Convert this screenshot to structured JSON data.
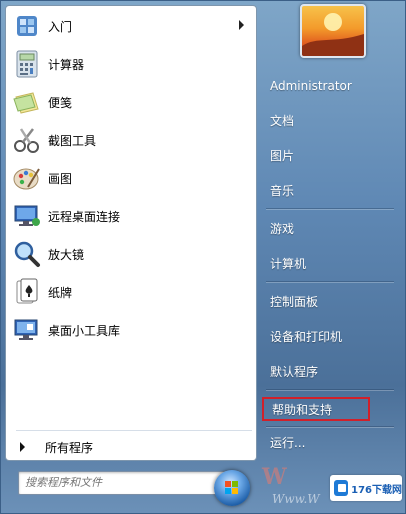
{
  "programs": [
    {
      "label": "入门",
      "icon": "getting-started-icon",
      "has_submenu": true
    },
    {
      "label": "计算器",
      "icon": "calculator-icon",
      "has_submenu": false
    },
    {
      "label": "便笺",
      "icon": "sticky-notes-icon",
      "has_submenu": false
    },
    {
      "label": "截图工具",
      "icon": "snipping-tool-icon",
      "has_submenu": false
    },
    {
      "label": "画图",
      "icon": "paint-icon",
      "has_submenu": false
    },
    {
      "label": "远程桌面连接",
      "icon": "remote-desktop-icon",
      "has_submenu": false
    },
    {
      "label": "放大镜",
      "icon": "magnifier-icon",
      "has_submenu": false
    },
    {
      "label": "纸牌",
      "icon": "solitaire-icon",
      "has_submenu": false
    },
    {
      "label": "桌面小工具库",
      "icon": "gadgets-icon",
      "has_submenu": false
    }
  ],
  "all_programs": "所有程序",
  "search": {
    "placeholder": "搜索程序和文件",
    "icon": "search-icon"
  },
  "user": {
    "name": "Administrator",
    "avatar": "user-avatar"
  },
  "right_menu": [
    {
      "label": "文档"
    },
    {
      "label": "图片"
    },
    {
      "label": "音乐"
    },
    {
      "label": "游戏"
    },
    {
      "label": "计算机"
    },
    {
      "label": "控制面板"
    },
    {
      "label": "设备和打印机"
    },
    {
      "label": "默认程序"
    },
    {
      "label": "帮助和支持",
      "highlighted": true
    },
    {
      "label": "运行..."
    }
  ],
  "watermark": {
    "text_large": "W",
    "text_small": "Www.W"
  },
  "badge": {
    "text": "176下载网"
  },
  "colors": {
    "highlight_border": "#d1202a",
    "pane_bg": "#ffffff",
    "right_text": "#ffffff"
  }
}
